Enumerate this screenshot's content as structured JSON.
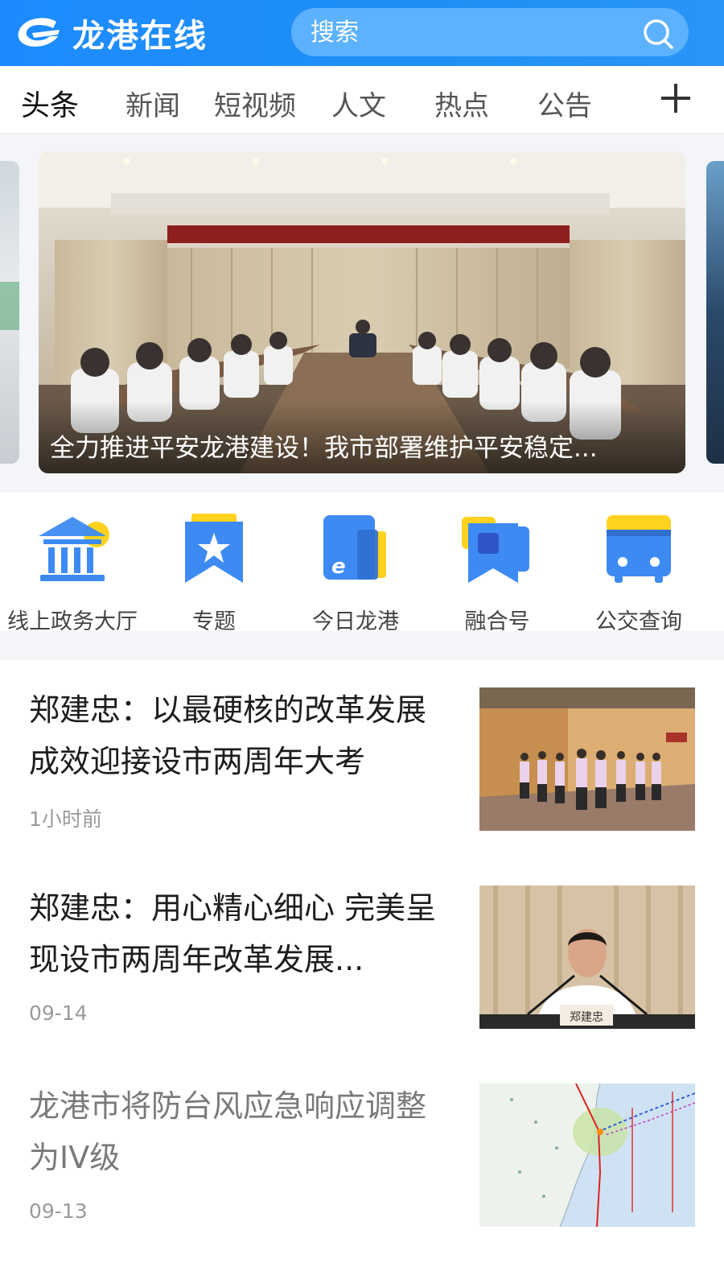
{
  "header": {
    "app_name": "龙港在线",
    "search_placeholder": "搜索",
    "brand_color": "#1d8bff"
  },
  "tabs": [
    {
      "label": "头条",
      "active": true
    },
    {
      "label": "新闻",
      "active": false
    },
    {
      "label": "短视频",
      "active": false
    },
    {
      "label": "人文",
      "active": false
    },
    {
      "label": "热点",
      "active": false
    },
    {
      "label": "公告",
      "active": false
    }
  ],
  "banner": {
    "caption": "全力推进平安龙港建设！我市部署维护平安稳定..."
  },
  "quick_links": [
    {
      "label": "线上政务大厅",
      "icon": "government-building-icon"
    },
    {
      "label": "专题",
      "icon": "star-bookmark-icon"
    },
    {
      "label": "今日龙港",
      "icon": "browser-e-icon"
    },
    {
      "label": "融合号",
      "icon": "media-bookmark-icon"
    },
    {
      "label": "公交查询",
      "icon": "bus-icon"
    }
  ],
  "news": [
    {
      "title": "郑建忠：以最硬核的改革发展成效迎接设市两周年大考",
      "time": "1小时前",
      "read": false
    },
    {
      "title": "郑建忠：用心精心细心 完美呈现设市两周年改革发展...",
      "time": "09-14",
      "read": false
    },
    {
      "title": "龙港市将防台风应急响应调整为IV级",
      "time": "09-13",
      "read": true
    }
  ],
  "thumb_text": {
    "nameplate": "郑建忠"
  }
}
